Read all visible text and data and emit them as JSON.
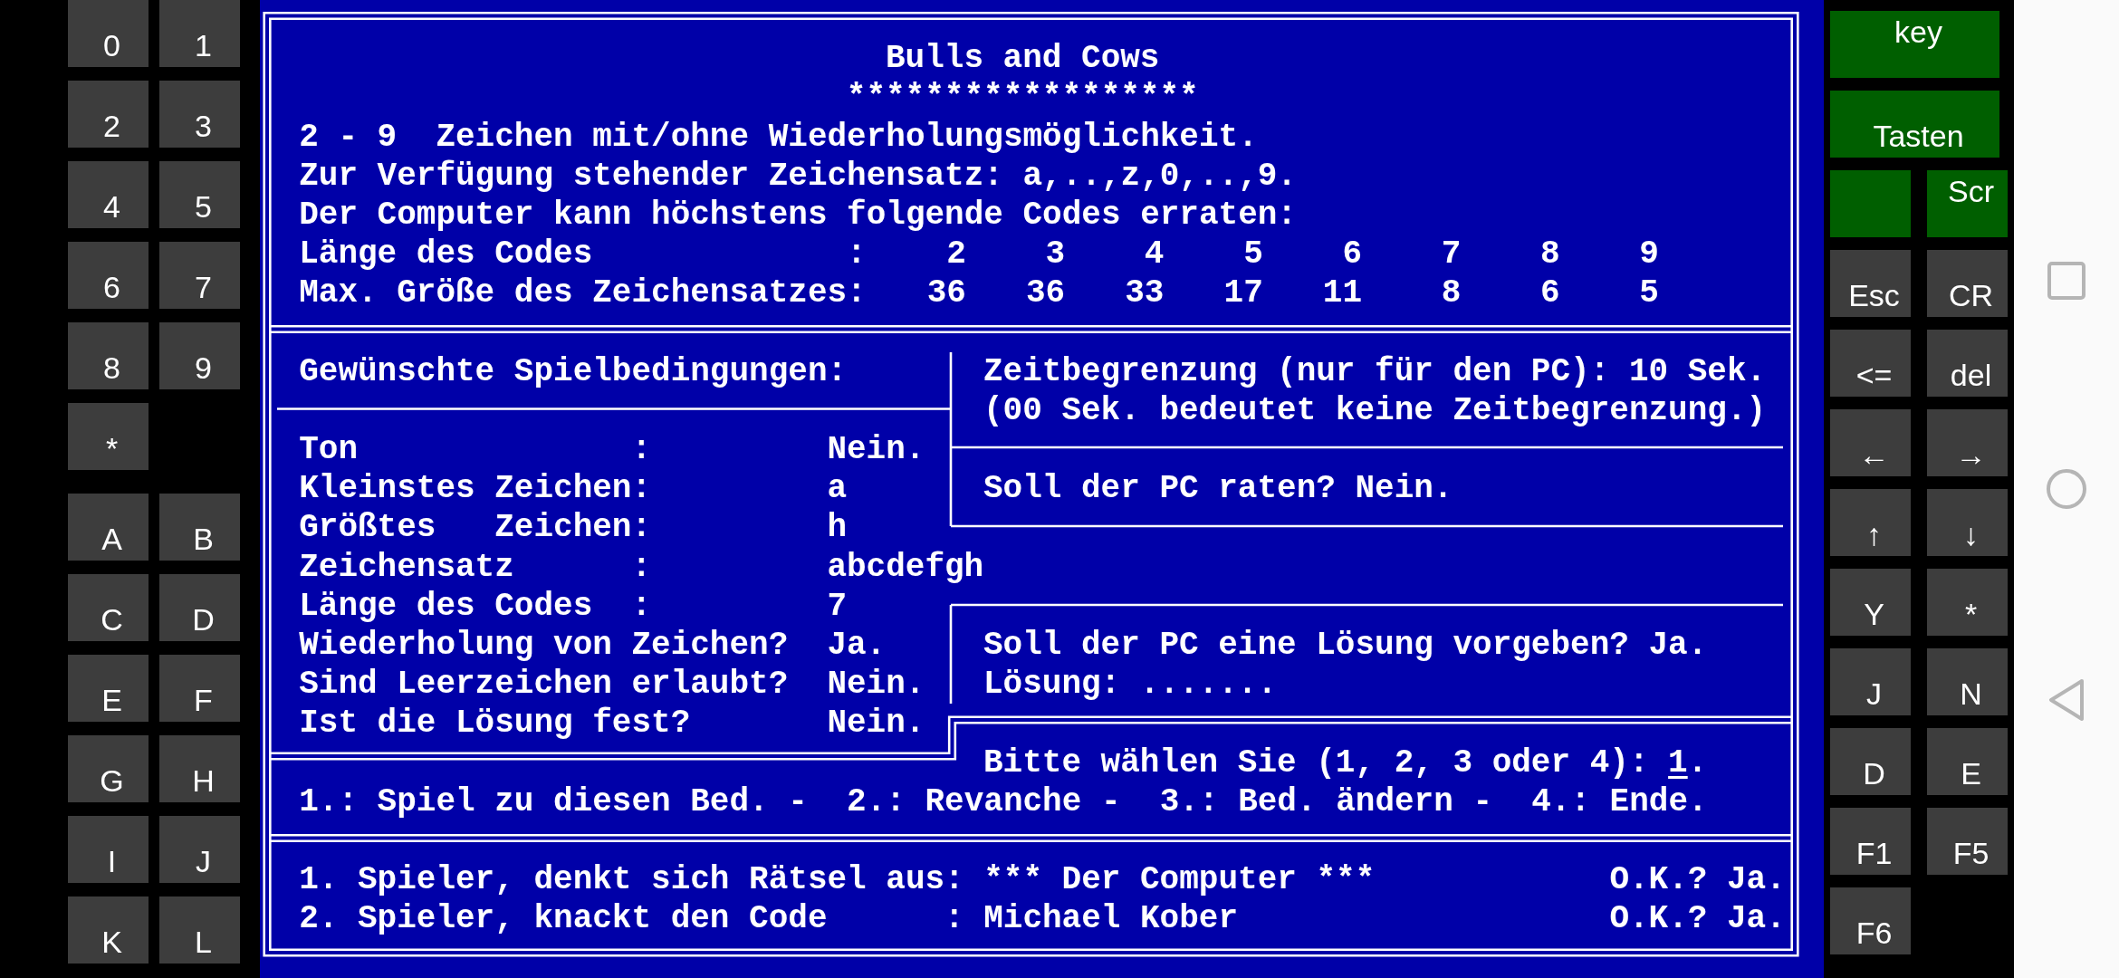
{
  "left_keypad": {
    "digit_rows": [
      [
        "0",
        "1"
      ],
      [
        "2",
        "3"
      ],
      [
        "4",
        "5"
      ],
      [
        "6",
        "7"
      ],
      [
        "8",
        "9"
      ],
      [
        "*"
      ]
    ],
    "letter_rows": [
      [
        "A",
        "B"
      ],
      [
        "C",
        "D"
      ],
      [
        "E",
        "F"
      ],
      [
        "G",
        "H"
      ],
      [
        "I",
        "J"
      ],
      [
        "K",
        "L"
      ]
    ]
  },
  "screen": {
    "title": "Bulls and Cows",
    "title_rule": "******************",
    "intro": [
      "2 - 9  Zeichen mit/ohne Wiederholungsmöglichkeit.",
      "Zur Verfügung stehender Zeichensatz: a,..,z,0,..,9.",
      "Der Computer kann höchstens folgende Codes erraten:"
    ],
    "capacity": [
      {
        "label": "Länge des Codes             :",
        "values": [
          "2",
          "3",
          "4",
          "5",
          "6",
          "7",
          "8",
          "9"
        ]
      },
      {
        "label": "Max. Größe des Zeichensatzes:",
        "values": [
          "36",
          "36",
          "33",
          "17",
          "11",
          "8",
          "6",
          "5"
        ]
      }
    ],
    "conditions": {
      "heading": "Gewünschte Spielbedingungen:",
      "rows": [
        {
          "label": "Ton              :",
          "value": "Nein."
        },
        {
          "label": "Kleinstes Zeichen:",
          "value": "a"
        },
        {
          "label": "Größtes   Zeichen:",
          "value": "h"
        },
        {
          "label": "Zeichensatz      :",
          "value": "abcdefgh"
        },
        {
          "label": "Länge des Codes  :",
          "value": "7"
        },
        {
          "label": "Wiederholung von Zeichen?",
          "value": "Ja."
        },
        {
          "label": "Sind Leerzeichen erlaubt?",
          "value": "Nein."
        },
        {
          "label": "Ist die Lösung fest?",
          "value": "Nein."
        }
      ]
    },
    "time_limit": [
      "Zeitbegrenzung (nur für den PC): 10 Sek.",
      "(00 Sek. bedeutet keine Zeitbegrenzung.)"
    ],
    "pc_guess": "Soll der PC raten? Nein.",
    "pc_solution": [
      "Soll der PC eine Lösung vorgeben? Ja.",
      "Lösung: ......."
    ],
    "choice": {
      "prompt": "Bitte wählen Sie (1, 2, 3 oder 4):",
      "value": "1",
      "end": "."
    },
    "menu": "1.: Spiel zu diesen Bed. -  2.: Revanche -  3.: Bed. ändern -  4.: Ende.",
    "players": [
      {
        "role": "1. Spieler, denkt sich Rätsel aus:",
        "name": "*** Der Computer ***",
        "confirm": "O.K.? Ja."
      },
      {
        "role": "2. Spieler, knackt den Code      :",
        "name": "Michael Kober",
        "confirm": "O.K.? Ja."
      }
    ]
  },
  "right_keypad": {
    "mode_keys": [
      "key",
      "Tasten"
    ],
    "screen_key": "Scr",
    "key_rows": [
      [
        "Esc",
        "CR"
      ],
      [
        "<=",
        "del"
      ],
      [
        "←",
        "→"
      ],
      [
        "↑",
        "↓"
      ],
      [
        "Y",
        "*"
      ],
      [
        "J",
        "N"
      ],
      [
        "D",
        "E"
      ],
      [
        "F1",
        "F5"
      ],
      [
        "F6"
      ]
    ]
  }
}
